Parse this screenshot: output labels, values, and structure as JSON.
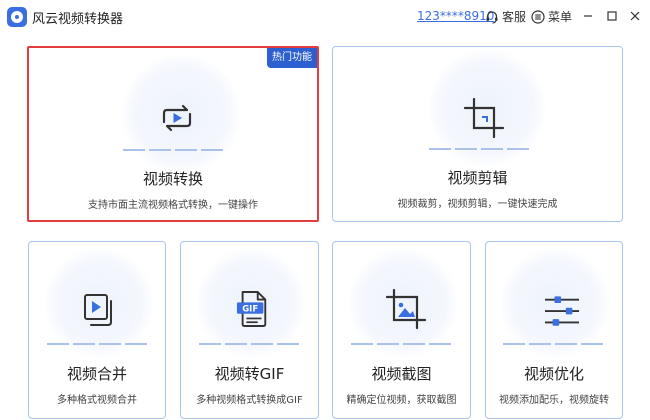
{
  "app": {
    "title": "风云视频转换器",
    "account": "123****8910",
    "service_label": "客服",
    "menu_label": "菜单"
  },
  "colors": {
    "accent": "#3b6fe0",
    "badge": "#2d5fd0",
    "card_border": "#a9c4ec",
    "selected_border": "#e23c3c",
    "icon_dark": "#333333"
  },
  "cards": [
    {
      "title": "视频转换",
      "desc": "支持市面主流视频格式转换，一键操作",
      "badge": "热门功能",
      "icon": "video-convert-icon",
      "selected": true
    },
    {
      "title": "视频剪辑",
      "desc": "视频裁剪，视频剪辑，一键快速完成",
      "icon": "crop-icon"
    },
    {
      "title": "视频合并",
      "desc": "多种格式视频合并",
      "icon": "video-merge-icon"
    },
    {
      "title": "视频转GIF",
      "desc": "多种视频格式转换成GIF",
      "icon": "gif-file-icon",
      "icon_text": "GIF"
    },
    {
      "title": "视频截图",
      "desc": "精确定位视频，获取截图",
      "icon": "screenshot-crop-icon"
    },
    {
      "title": "视频优化",
      "desc": "视频添加配乐，视频旋转",
      "icon": "sliders-icon"
    }
  ]
}
